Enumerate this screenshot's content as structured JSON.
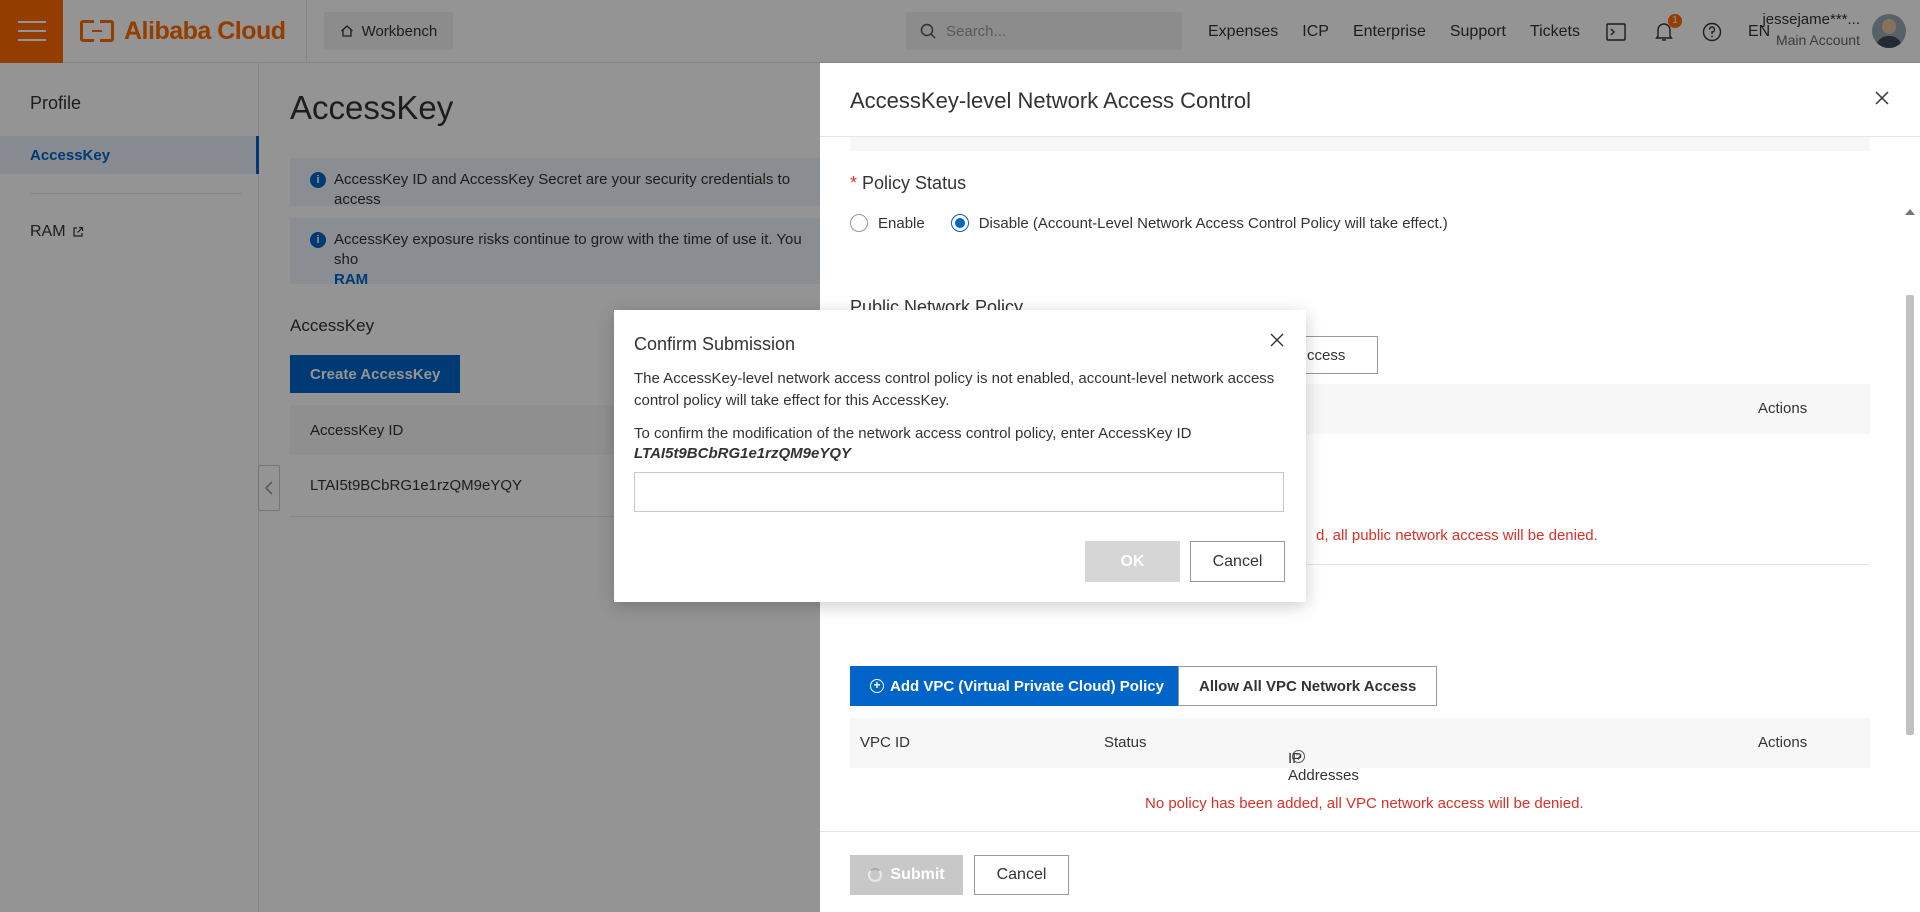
{
  "topbar": {
    "brand": "Alibaba Cloud",
    "workbench": "Workbench",
    "search_placeholder": "Search...",
    "links": [
      "Expenses",
      "ICP",
      "Enterprise",
      "Support",
      "Tickets"
    ],
    "notification_count": "1",
    "language": "EN",
    "user_name": "jessejame***...",
    "user_role": "Main Account"
  },
  "sidebar": {
    "title": "Profile",
    "items": [
      {
        "label": "AccessKey",
        "active": true
      },
      {
        "label": "RAM",
        "external": true
      }
    ]
  },
  "main": {
    "page_title": "AccessKey",
    "alert1": "AccessKey ID and AccessKey Secret are your security credentials to access",
    "alert2": "AccessKey exposure risks continue to grow with the time of use it. You sho",
    "alert2_link": "RAM",
    "section_title": "AccessKey",
    "create_button": "Create AccessKey",
    "table_header": "AccessKey ID",
    "rows": [
      {
        "id": "LTAI5t9BCbRG1e1rzQM9eYQY"
      }
    ]
  },
  "drawer": {
    "title": "AccessKey-level Network Access Control",
    "policy_status_label": "Policy Status",
    "required_mark": "*",
    "radio_enable": "Enable",
    "radio_disable": "Disable (Account-Level Network Access Control Policy will take effect.)",
    "selected": "disable",
    "public_policy_label": "Public Network Policy",
    "public_partial_button": "ccess",
    "actions_header": "Actions",
    "public_deny_message": "d, all public network access will be denied.",
    "vpc_add_button": "Add VPC (Virtual Private Cloud) Policy",
    "vpc_allow_button": "Allow All VPC Network Access",
    "vpc_columns": [
      "VPC ID",
      "Status",
      "IP Addresses",
      "Actions"
    ],
    "vpc_deny_message": "No policy has been added, all VPC network access will be denied.",
    "submit": "Submit",
    "cancel": "Cancel"
  },
  "dialog": {
    "title": "Confirm Submission",
    "message": "The AccessKey-level network access control policy is not enabled, account-level network access control policy will take effect for this AccessKey.",
    "prompt": "To confirm the modification of the network access control policy, enter AccessKey ID",
    "access_key_id": "LTAI5t9BCbRG1e1rzQM9eYQY",
    "input_value": "",
    "ok": "OK",
    "cancel": "Cancel"
  }
}
